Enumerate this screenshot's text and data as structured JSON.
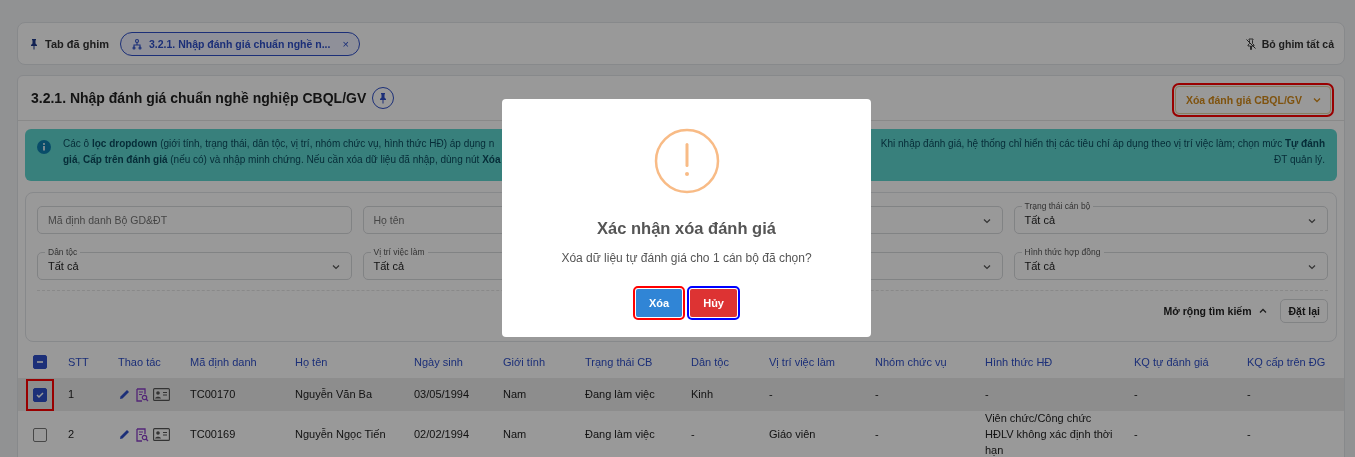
{
  "pinned_bar": {
    "label": "Tab đã ghim",
    "tabs": [
      {
        "label": "3.2.1. Nhập đánh giá chuẩn nghề n...",
        "selected": true,
        "close": "×"
      }
    ],
    "unpin_all": "Bỏ ghim tất cả"
  },
  "page": {
    "title": "3.2.1. Nhập đánh giá chuẩn nghề nghiệp CBQL/GV",
    "pinned": true,
    "action_menu": {
      "label": "Xóa đánh giá CBQL/GV",
      "highlighted": true
    }
  },
  "notice": {
    "lines": [
      {
        "left": "Các ô **lọc dropdown** (giới tính, trạng thái, dân tộc, vị trí, nhóm chức vụ, hình thức HĐ) áp dụng n",
        "right": "Khi nhập đánh giá, hệ thống chỉ hiển thị các tiêu chí áp dụng theo vị trí việc làm; chọn mức **Tự đánh**"
      },
      {
        "left": "**giá**, **Cấp trên đánh giá** (nếu có) và nhập minh chứng. Nếu cần xóa dữ liệu đã nhập, dùng nút **Xóa**",
        "right": "ĐT quản lý."
      }
    ]
  },
  "filters": [
    [
      {
        "kind": "text",
        "placeholder": "Mã định danh Bộ GD&ĐT"
      },
      {
        "kind": "text",
        "placeholder": "Họ tên"
      },
      {
        "kind": "select"
      },
      {
        "kind": "select",
        "label": "Trạng thái cán bộ",
        "value": "Tất cả"
      }
    ],
    [
      {
        "kind": "select",
        "label": "Dân tộc",
        "value": "Tất cả"
      },
      {
        "kind": "select_partial",
        "label": "Vị trí việc làm",
        "value": "Tất cả"
      },
      {
        "kind": "select"
      },
      {
        "kind": "select",
        "label": "Hình thức hợp đồng",
        "value": "Tất cả"
      }
    ]
  ],
  "filter_footer": {
    "expand": "Mở rộng tìm kiếm",
    "expanded": true,
    "reset": "Đặt lại"
  },
  "table": {
    "select_all": {
      "indeterminate": true
    },
    "columns": [
      "STT",
      "Thao tác",
      "Mã định danh",
      "Họ tên",
      "Ngày sinh",
      "Giới tính",
      "Trạng thái CB",
      "Dân tộc",
      "Vị trí việc làm",
      "Nhóm chức vụ",
      "Hình thức HĐ",
      "KQ tự đánh giá",
      "KQ cấp trên ĐG"
    ],
    "rows": [
      {
        "checked": true,
        "highlighted": true,
        "cells": [
          "1",
          "",
          "TC00170",
          "Nguyễn Văn Ba",
          "03/05/1994",
          "Nam",
          "Đang làm việc",
          "Kinh",
          "-",
          "-",
          "-",
          "-",
          "-"
        ]
      },
      {
        "checked": false,
        "highlighted": false,
        "cells": [
          "2",
          "",
          "TC00169",
          "Nguyễn Ngọc Tiến",
          "02/02/1994",
          "Nam",
          "Đang làm việc",
          "-",
          "Giáo viên",
          "-",
          "Viên chức/Công chức HĐLV không xác định thời hạn",
          "-",
          "-"
        ]
      }
    ]
  },
  "dialog": {
    "title": "Xác nhận xóa đánh giá",
    "message": "Xóa dữ liệu tự đánh giá cho 1 cán bộ đã chọn?",
    "buttons": [
      {
        "label": "Xóa",
        "kind": "confirm",
        "highlighted": true
      },
      {
        "label": "Hủy",
        "kind": "cancel",
        "highlighted": true
      }
    ]
  }
}
